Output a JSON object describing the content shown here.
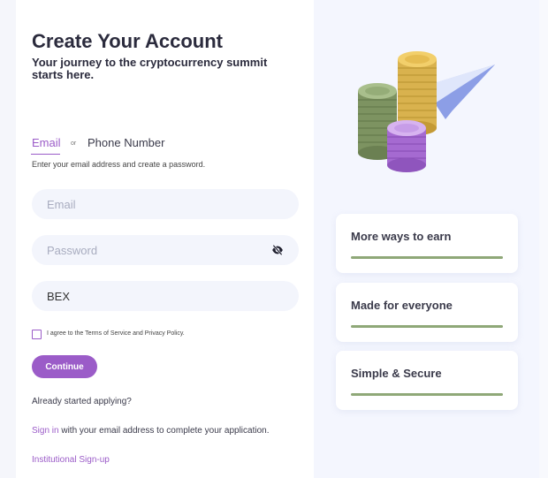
{
  "header": {
    "title": "Create Your Account",
    "subtitle": "Your journey to the cryptocurrency summit starts here."
  },
  "tabs": {
    "email_label": "Email",
    "or_label": "or",
    "phone_label": "Phone Number",
    "active": "Email"
  },
  "form": {
    "hint": "Enter your email address and create a password.",
    "email_placeholder": "Email",
    "email_value": "",
    "password_placeholder": "Password",
    "password_value": "",
    "referral_value": "BEX",
    "terms_label": "I agree to the Terms of Service and Privacy Policy.",
    "terms_checked": false,
    "continue_label": "Continue"
  },
  "footer": {
    "already_label": "Already started applying?",
    "signin_link": "Sign in",
    "signin_rest": " with your email address to complete your application.",
    "institutional_label": "Institutional Sign-up"
  },
  "features": [
    {
      "label": "More ways to earn"
    },
    {
      "label": "Made for everyone"
    },
    {
      "label": "Simple & Secure"
    }
  ],
  "colors": {
    "accent": "#9b5cc8",
    "field_bg": "#f3f5fc",
    "panel_bg": "#f4f6fe",
    "feature_bar": "#8fa878"
  },
  "icons": {
    "password_toggle": "eye-slash-icon",
    "illustration": "coins-paper-plane-illustration"
  }
}
